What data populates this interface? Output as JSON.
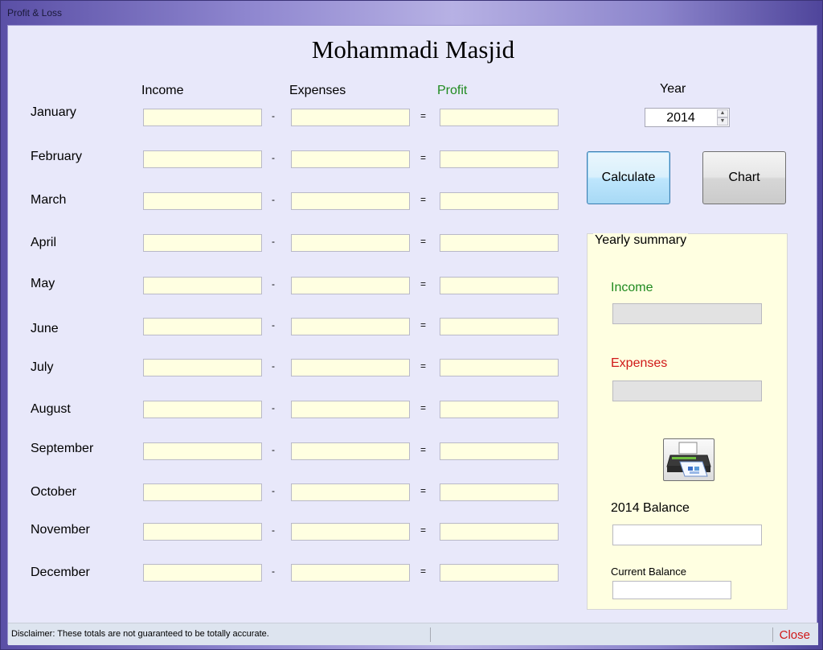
{
  "window": {
    "title": "Profit & Loss"
  },
  "app_title": "Mohammadi Masjid",
  "columns": {
    "income": "Income",
    "expenses": "Expenses",
    "profit": "Profit"
  },
  "operators": {
    "minus": "-",
    "equals": "="
  },
  "months": [
    {
      "label": "January",
      "income": "",
      "expenses": "",
      "profit": ""
    },
    {
      "label": "February",
      "income": "",
      "expenses": "",
      "profit": ""
    },
    {
      "label": "March",
      "income": "",
      "expenses": "",
      "profit": ""
    },
    {
      "label": "April",
      "income": "",
      "expenses": "",
      "profit": ""
    },
    {
      "label": "May",
      "income": "",
      "expenses": "",
      "profit": ""
    },
    {
      "label": "June",
      "income": "",
      "expenses": "",
      "profit": ""
    },
    {
      "label": "July",
      "income": "",
      "expenses": "",
      "profit": ""
    },
    {
      "label": "August",
      "income": "",
      "expenses": "",
      "profit": ""
    },
    {
      "label": "September",
      "income": "",
      "expenses": "",
      "profit": ""
    },
    {
      "label": "October",
      "income": "",
      "expenses": "",
      "profit": ""
    },
    {
      "label": "November",
      "income": "",
      "expenses": "",
      "profit": ""
    },
    {
      "label": "December",
      "income": "",
      "expenses": "",
      "profit": ""
    }
  ],
  "year": {
    "label": "Year",
    "value": "2014"
  },
  "buttons": {
    "calculate": "Calculate",
    "chart": "Chart"
  },
  "summary": {
    "title": "Yearly summary",
    "income_label": "Income",
    "income_value": "",
    "expenses_label": "Expenses",
    "expenses_value": "",
    "balance_label": "2014 Balance",
    "balance_value": "",
    "current_balance_label": "Current Balance",
    "current_balance_value": ""
  },
  "status": {
    "disclaimer": "Disclaimer: These totals are not guaranteed to be totally accurate.",
    "close": "Close"
  },
  "colors": {
    "profit": "#1f8a1f",
    "expenses": "#d01818",
    "field_bg": "#ffffe1",
    "client_bg": "#e8e8fa"
  },
  "icons": {
    "print": "printer-icon",
    "spin_up": "spin-up-icon",
    "spin_down": "spin-down-icon"
  }
}
